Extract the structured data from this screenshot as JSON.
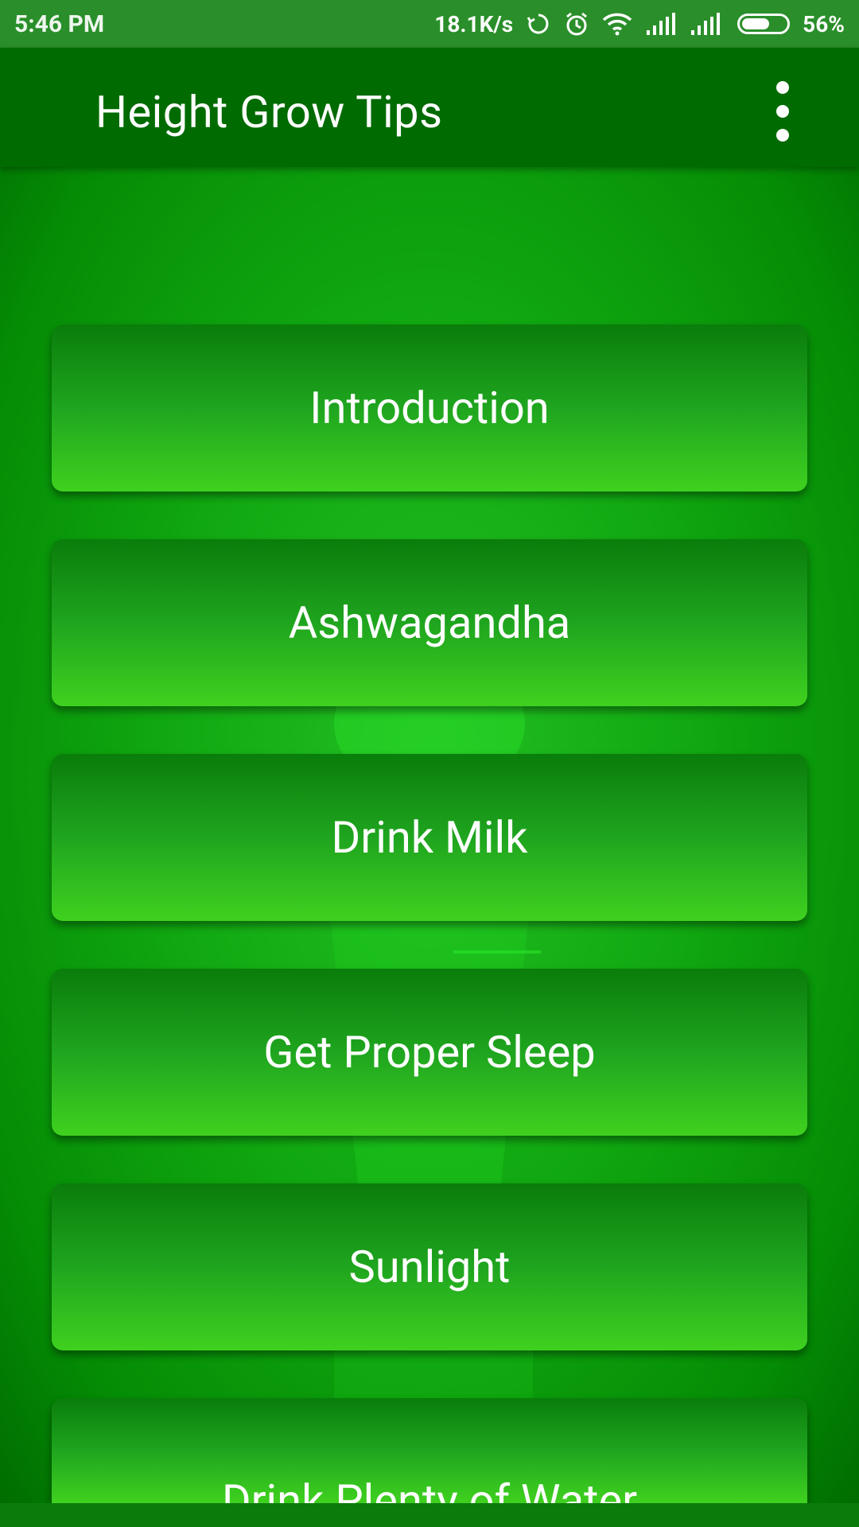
{
  "status_bar": {
    "time": "5:46 PM",
    "net_speed": "18.1K/s",
    "battery_percent": "56%",
    "icons": [
      "sync-icon",
      "alarm-icon",
      "wifi-icon",
      "signal-icon",
      "signal-icon",
      "battery-icon"
    ]
  },
  "app_bar": {
    "title": "Height Grow Tips",
    "menu_icon": "more-vert-icon"
  },
  "tips": [
    {
      "label": "Introduction"
    },
    {
      "label": "Ashwagandha"
    },
    {
      "label": "Drink Milk"
    },
    {
      "label": "Get Proper Sleep"
    },
    {
      "label": "Sunlight"
    },
    {
      "label": "Drink Plenty of Water"
    }
  ],
  "colors": {
    "status_bar": "#2a8f2a",
    "app_bar": "#006b00",
    "button_top": "#0a7d0a",
    "button_bottom": "#3fd11f",
    "text": "#ffffff"
  }
}
